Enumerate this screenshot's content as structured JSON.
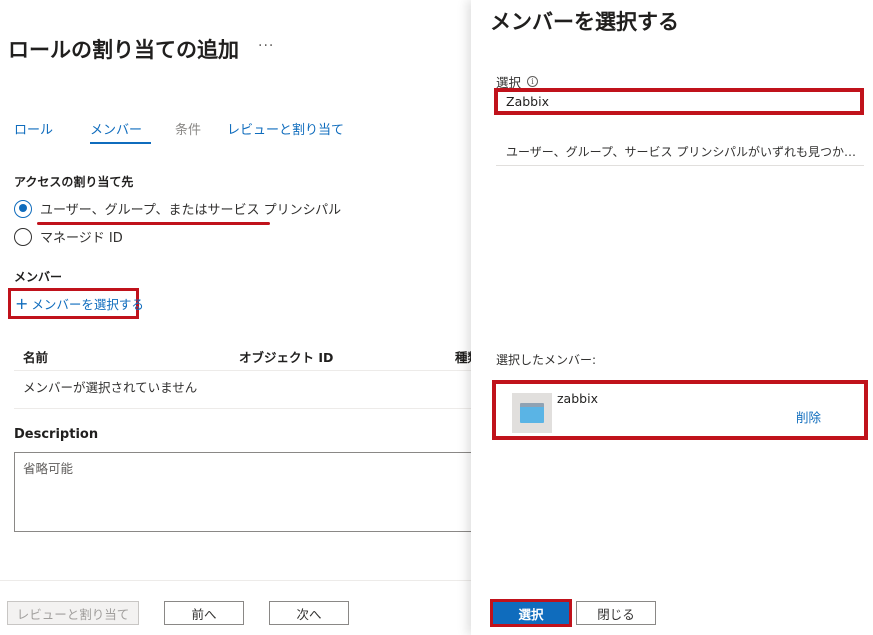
{
  "page": {
    "title": "ロールの割り当ての追加",
    "more": "···"
  },
  "tabs": [
    {
      "label": "ロール",
      "state": "link"
    },
    {
      "label": "メンバー",
      "state": "active"
    },
    {
      "label": "条件",
      "state": "disabled"
    },
    {
      "label": "レビューと割り当て",
      "state": "link"
    }
  ],
  "access": {
    "label": "アクセスの割り当て先",
    "options": [
      {
        "label": "ユーザー、グループ、またはサービス プリンシパル",
        "checked": true
      },
      {
        "label": "マネージド ID",
        "checked": false
      }
    ]
  },
  "members": {
    "label": "メンバー",
    "select_link": "メンバーを選択する",
    "columns": [
      "名前",
      "オブジェクト ID",
      "種類"
    ],
    "empty_text": "メンバーが選択されていません"
  },
  "description": {
    "label": "Description",
    "placeholder": "省略可能"
  },
  "footer": {
    "review": "レビューと割り当て",
    "prev": "前へ",
    "next": "次へ"
  },
  "panel": {
    "title": "メンバーを選択する",
    "search_label": "選択",
    "search_value": "Zabbix",
    "no_result": "ユーザー、グループ、サービス プリンシパルがいずれも見つかりませんでした。",
    "selected_label": "選択したメンバー:",
    "selected_member": {
      "name": "zabbix",
      "remove": "削除"
    },
    "select_button": "選択",
    "close_button": "閉じる"
  },
  "colors": {
    "accent": "#0f6cbd",
    "highlight": "#c0121b"
  },
  "icons": {
    "info": "info-icon",
    "plus": "plus-icon",
    "app": "app-registration-icon"
  }
}
